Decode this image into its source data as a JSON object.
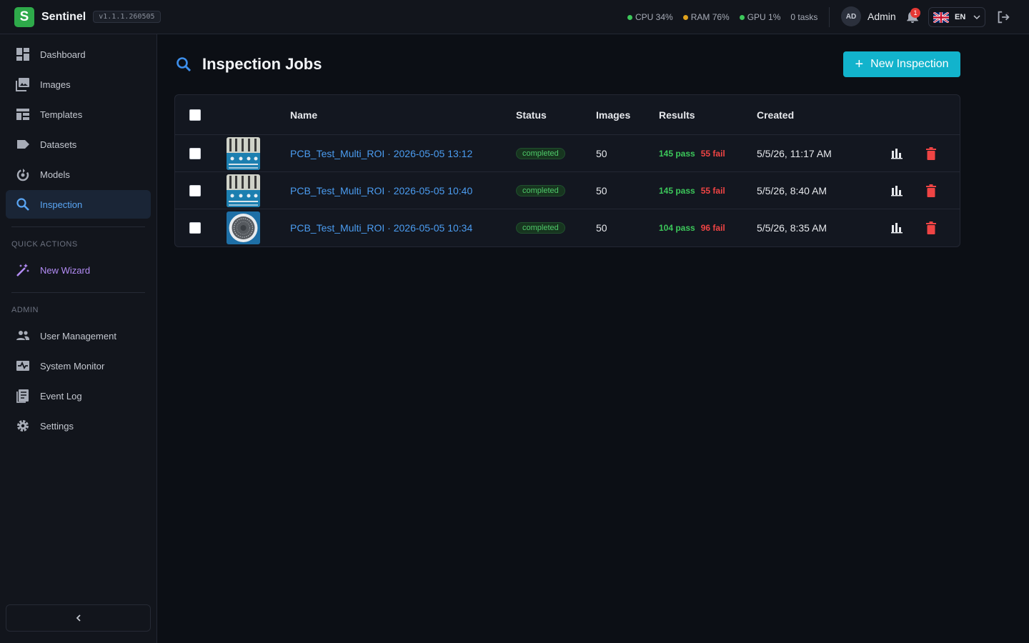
{
  "app": {
    "brand_letter": "S",
    "name": "Sentinel",
    "version": "v1.1.1.260505",
    "accent": "#12b3cc",
    "brand_color": "#2eaa4a"
  },
  "header": {
    "stats": {
      "cpu": "CPU 34%",
      "ram": "RAM 76%",
      "gpu": "GPU 1%",
      "tasks": "0 tasks"
    },
    "user": {
      "initials": "AD",
      "name": "Admin"
    },
    "notifications_count": "1",
    "language": {
      "code": "EN",
      "flag_icon": "uk-flag-icon"
    },
    "logout_icon": "logout-icon"
  },
  "sidebar": {
    "items": [
      {
        "label": "Dashboard",
        "icon": "dashboard-icon"
      },
      {
        "label": "Images",
        "icon": "images-icon"
      },
      {
        "label": "Templates",
        "icon": "templates-icon"
      },
      {
        "label": "Datasets",
        "icon": "datasets-icon"
      },
      {
        "label": "Models",
        "icon": "models-icon"
      },
      {
        "label": "Inspection",
        "icon": "search-icon",
        "active": true
      }
    ],
    "quick_actions_label": "QUICK ACTIONS",
    "quick_actions": [
      {
        "label": "New Wizard",
        "icon": "magic-wand-icon"
      }
    ],
    "admin_label": "ADMIN",
    "admin_items": [
      {
        "label": "User Management",
        "icon": "users-icon"
      },
      {
        "label": "System Monitor",
        "icon": "monitor-icon"
      },
      {
        "label": "Event Log",
        "icon": "log-icon"
      },
      {
        "label": "Settings",
        "icon": "gear-icon"
      }
    ],
    "collapse_icon": "chevron-left-icon"
  },
  "main": {
    "title": "Inspection Jobs",
    "new_button": "New Inspection",
    "table": {
      "columns": [
        "Name",
        "Status",
        "Images",
        "Results",
        "Created"
      ],
      "rows": [
        {
          "name": "PCB_Test_Multi_ROI · 2026-05-05 13:12",
          "status": "completed",
          "images": "50",
          "pass": "145 pass",
          "fail": "55 fail",
          "created": "5/5/26, 11:17 AM",
          "thumbnail": "pcb-thumbnail"
        },
        {
          "name": "PCB_Test_Multi_ROI · 2026-05-05 10:40",
          "status": "completed",
          "images": "50",
          "pass": "145 pass",
          "fail": "55 fail",
          "created": "5/5/26, 8:40 AM",
          "thumbnail": "pcb-thumbnail"
        },
        {
          "name": "PCB_Test_Multi_ROI · 2026-05-05 10:34",
          "status": "completed",
          "images": "50",
          "pass": "104 pass",
          "fail": "96 fail",
          "created": "5/5/26, 8:35 AM",
          "thumbnail": "round-part-thumbnail"
        }
      ]
    }
  }
}
